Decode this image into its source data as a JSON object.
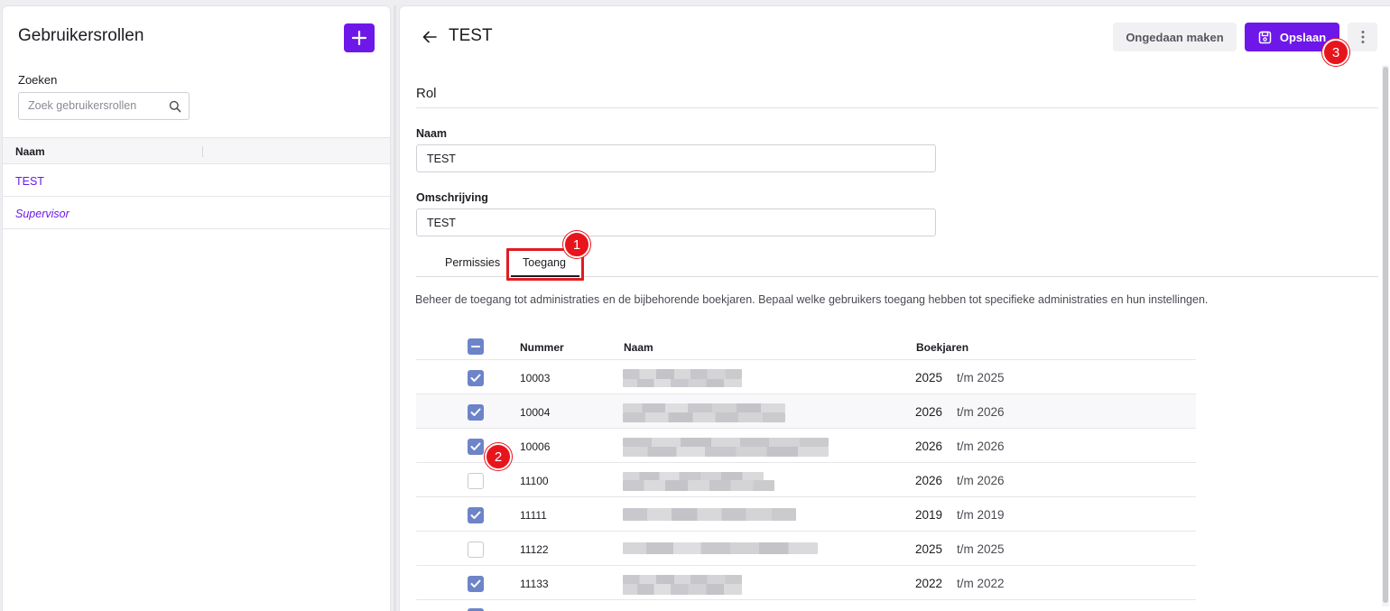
{
  "sidebar": {
    "title": "Gebruikersrollen",
    "search_label": "Zoeken",
    "search_placeholder": "Zoek gebruikersrollen",
    "column_header": "Naam",
    "items": [
      {
        "label": "TEST"
      },
      {
        "label": "Supervisor"
      }
    ]
  },
  "header": {
    "title": "TEST",
    "undo_label": "Ongedaan maken",
    "save_label": "Opslaan"
  },
  "form": {
    "section_title": "Rol",
    "name_label": "Naam",
    "name_value": "TEST",
    "description_label": "Omschrijving",
    "description_value": "TEST"
  },
  "tabs": [
    {
      "label": "Permissies",
      "active": false
    },
    {
      "label": "Toegang",
      "active": true
    }
  ],
  "access": {
    "description": "Beheer de toegang tot administraties en de bijbehorende boekjaren. Bepaal welke gebruikers toegang hebben tot specifieke administraties en hun instellingen.",
    "columns": {
      "number": "Nummer",
      "name": "Naam",
      "years": "Boekjaren"
    },
    "rows": [
      {
        "checked": true,
        "number": "10003",
        "from": "2025",
        "to": "t/m 2025"
      },
      {
        "checked": true,
        "number": "10004",
        "from": "2026",
        "to": "t/m 2026"
      },
      {
        "checked": true,
        "number": "10006",
        "from": "2026",
        "to": "t/m 2026"
      },
      {
        "checked": false,
        "number": "11100",
        "from": "2026",
        "to": "t/m 2026"
      },
      {
        "checked": true,
        "number": "11111",
        "from": "2019",
        "to": "t/m 2019"
      },
      {
        "checked": false,
        "number": "11122",
        "from": "2025",
        "to": "t/m 2025"
      },
      {
        "checked": true,
        "number": "11133",
        "from": "2022",
        "to": "t/m 2022"
      }
    ]
  },
  "annotations": [
    "1",
    "2",
    "3"
  ],
  "colors": {
    "accent": "#6d18e8",
    "checkbox": "#6d84c9",
    "annotation": "#e8141c"
  }
}
